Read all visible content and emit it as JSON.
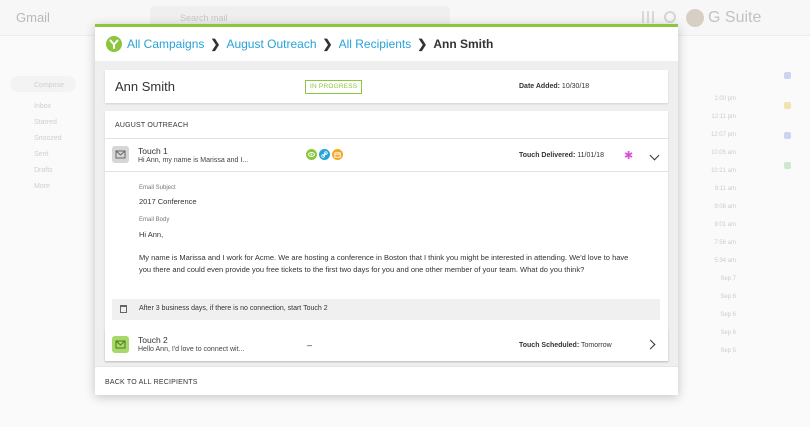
{
  "background": {
    "app_name": "Gmail",
    "search_placeholder": "Search mail",
    "suite_label": "G Suite",
    "sidebar_items": [
      "Compose",
      "Inbox",
      "Starred",
      "Snoozed",
      "Sent",
      "Drafts",
      "More"
    ],
    "times": [
      "1:00 pm",
      "12:11 pm",
      "12:07 pm",
      "10:05 am",
      "10:21 am",
      "9:11 am",
      "9:08 am",
      "9:01 am",
      "7:56 am",
      "5:34 am",
      "Sep 7",
      "Sep 6",
      "Sep 6",
      "Sep 6",
      "Sep 5"
    ]
  },
  "modal": {
    "accent_color": "#8cc63f",
    "breadcrumb": {
      "items": [
        "All Campaigns",
        "August Outreach",
        "All Recipients"
      ],
      "current": "Ann Smith",
      "separator": "❯"
    },
    "recipient": {
      "name": "Ann Smith",
      "status": "IN PROGRESS",
      "date_label": "Date Added:",
      "date_value": "10/30/18"
    },
    "campaign": {
      "title": "AUGUST OUTREACH",
      "touches": [
        {
          "title": "Touch 1",
          "snippet": "Hi Ann, my name is Marissa and I...",
          "status_label": "Touch Delivered:",
          "status_value": "11/01/18",
          "icon": "envelope-icon",
          "channel_icons": [
            "view-icon",
            "link-icon",
            "reply-icon"
          ],
          "expanded": true,
          "email_subject_label": "Email Subject",
          "email_subject": "2017 Conference",
          "email_body_label": "Email Body",
          "greeting": "Hi Ann,",
          "body": "My name is Marissa and I work for Acme. We are hosting a conference in Boston that I think you might be interested in attending. We'd love to have you there and could even provide you free tickets to the first two days for you and one other member of your team. What do you think?",
          "rule": "After 3 business days, if there is no connection, start Touch 2"
        },
        {
          "title": "Touch 2",
          "snippet": "Hello Ann, I'd love to connect wit...",
          "dash": "–",
          "status_label": "Touch Scheduled:",
          "status_value": "Tomorrow",
          "icon": "envelope-icon",
          "expanded": false
        }
      ]
    },
    "footer": {
      "back_label": "BACK TO ALL RECIPIENTS"
    }
  }
}
